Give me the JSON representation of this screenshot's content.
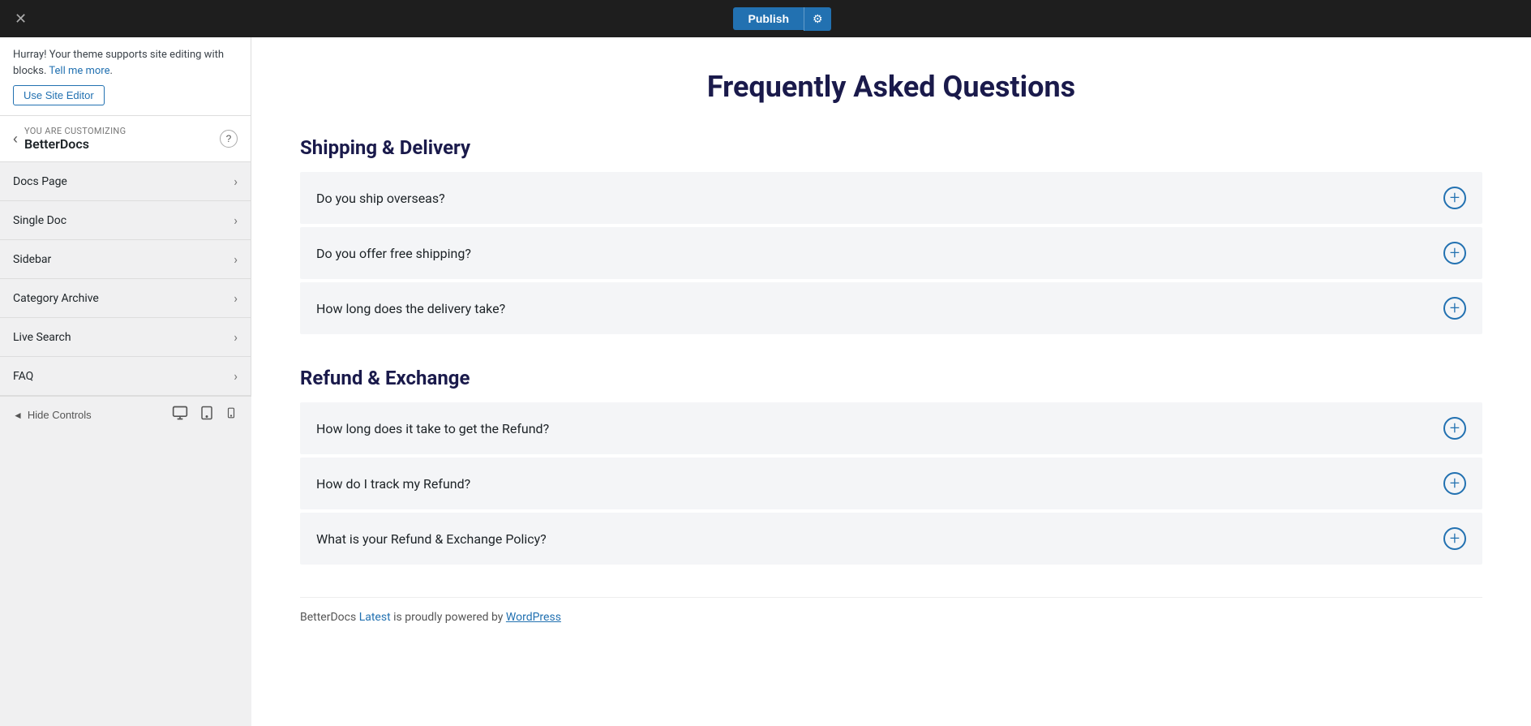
{
  "topbar": {
    "close_label": "✕",
    "publish_label": "Publish",
    "settings_icon": "⚙"
  },
  "sidebar": {
    "customizing_label": "You are customizing",
    "customizing_title": "BetterDocs",
    "help_label": "?",
    "back_label": "‹",
    "notice": {
      "text": "Hurray! Your theme supports site editing with blocks. ",
      "link_text": "Tell me more",
      "link_href": "#"
    },
    "use_site_editor_label": "Use Site Editor",
    "nav_items": [
      {
        "label": "Docs Page"
      },
      {
        "label": "Single Doc"
      },
      {
        "label": "Sidebar"
      },
      {
        "label": "Category Archive"
      },
      {
        "label": "Live Search"
      },
      {
        "label": "FAQ"
      }
    ]
  },
  "bottombar": {
    "hide_controls_label": "Hide Controls",
    "arrow_label": "◄",
    "device_icons": [
      "desktop",
      "tablet",
      "mobile"
    ]
  },
  "content": {
    "page_title": "Frequently Asked Questions",
    "sections": [
      {
        "title": "Shipping & Delivery",
        "items": [
          "Do you ship overseas?",
          "Do you offer free shipping?",
          "How long does the delivery take?"
        ]
      },
      {
        "title": "Refund & Exchange",
        "items": [
          "How long does it take to get the Refund?",
          "How do I track my Refund?",
          "What is your Refund & Exchange Policy?"
        ]
      }
    ],
    "footer": {
      "text_before": "BetterDocs ",
      "brand": "Latest",
      "text_middle": " is proudly powered by ",
      "link_text": "WordPress",
      "link_href": "#"
    }
  }
}
